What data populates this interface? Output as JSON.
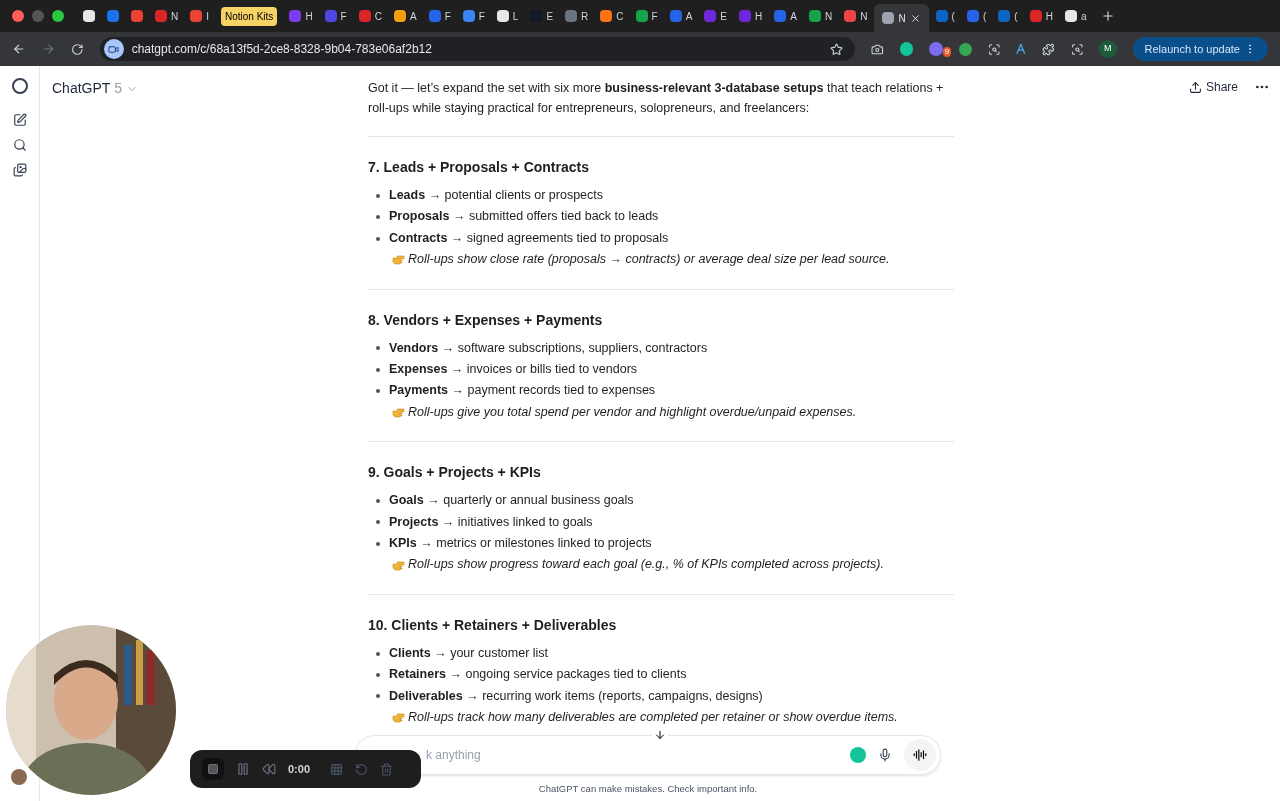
{
  "browser": {
    "tabs": [
      {
        "color": "#e5e7eb",
        "selected": false
      },
      {
        "color": "#1a73e8",
        "selected": false
      },
      {
        "color": "#ea4335",
        "selected": false
      },
      {
        "label": "N",
        "color": "#dc2626",
        "selected": false
      },
      {
        "label": "I",
        "color": "#ea4335",
        "selected": false
      },
      {
        "label": "Notion Kits",
        "color": "#f6d365",
        "selected": false
      },
      {
        "label": "H",
        "color": "#7c3aed",
        "selected": false
      },
      {
        "label": "F",
        "color": "#4f46e5",
        "selected": false
      },
      {
        "label": "C",
        "color": "#dc2626",
        "selected": false
      },
      {
        "label": "A",
        "color": "#f59e0b",
        "selected": false
      },
      {
        "label": "F",
        "color": "#2563eb",
        "selected": false
      },
      {
        "label": "F",
        "color": "#3b82f6",
        "selected": false
      },
      {
        "label": "L",
        "color": "#e5e7eb",
        "selected": false
      },
      {
        "label": "E",
        "color": "#111827",
        "selected": false
      },
      {
        "label": "R",
        "color": "#6b7280",
        "selected": false
      },
      {
        "label": "C",
        "color": "#f97316",
        "selected": false
      },
      {
        "label": "F",
        "color": "#16a34a",
        "selected": false
      },
      {
        "label": "A",
        "color": "#2563eb",
        "selected": false
      },
      {
        "label": "E",
        "color": "#6d28d9",
        "selected": false
      },
      {
        "label": "H",
        "color": "#6d28d9",
        "selected": false
      },
      {
        "label": "A",
        "color": "#2563eb",
        "selected": false
      },
      {
        "label": "N",
        "color": "#16a34a",
        "selected": false
      },
      {
        "label": "N",
        "color": "#ef4444",
        "selected": false
      },
      {
        "label": "N",
        "color": "#9ca3af",
        "selected": true
      },
      {
        "label": "(",
        "color": "#0a66c2",
        "selected": false
      },
      {
        "label": "(",
        "color": "#2563eb",
        "selected": false
      },
      {
        "label": "(",
        "color": "#0a66c2",
        "selected": false
      },
      {
        "label": "H",
        "color": "#dc2626",
        "selected": false
      },
      {
        "label": "a",
        "color": "#e5e7eb",
        "selected": false
      }
    ],
    "url": "chatgpt.com/c/68a13f5d-2ce8-8328-9b04-783e06af2b12",
    "extension_badge": "9",
    "profile": "M",
    "relaunch_button": "Relaunch to update"
  },
  "header": {
    "model": "ChatGPT",
    "version": "5",
    "share": "Share"
  },
  "intro": "Got it — let’s expand the set with six more **business-relevant 3-database setups** that teach relations + roll-ups while staying practical for entrepreneurs, solopreneurs, and freelancers:",
  "sections": [
    {
      "title": "7. Leads + Proposals + Contracts",
      "items": [
        {
          "term": "Leads",
          "desc": "→ potential clients or prospects"
        },
        {
          "term": "Proposals",
          "desc": "→ submitted offers tied back to leads"
        },
        {
          "term": "Contracts",
          "desc": "→ signed agreements tied to proposals"
        }
      ],
      "note": "Roll-ups show close rate (proposals → contracts) or average deal size per lead source."
    },
    {
      "title": "8. Vendors + Expenses + Payments",
      "items": [
        {
          "term": "Vendors",
          "desc": "→ software subscriptions, suppliers, contractors"
        },
        {
          "term": "Expenses",
          "desc": "→ invoices or bills tied to vendors"
        },
        {
          "term": "Payments",
          "desc": "→ payment records tied to expenses"
        }
      ],
      "note": "Roll-ups give you total spend per vendor and highlight overdue/unpaid expenses."
    },
    {
      "title": "9. Goals + Projects + KPIs",
      "items": [
        {
          "term": "Goals",
          "desc": "→ quarterly or annual business goals"
        },
        {
          "term": "Projects",
          "desc": "→ initiatives linked to goals"
        },
        {
          "term": "KPIs",
          "desc": "→ metrics or milestones linked to projects"
        }
      ],
      "note": "Roll-ups show progress toward each goal (e.g., % of KPIs completed across projects)."
    },
    {
      "title": "10. Clients + Retainers + Deliverables",
      "items": [
        {
          "term": "Clients",
          "desc": "→ your customer list"
        },
        {
          "term": "Retainers",
          "desc": "→ ongoing service packages tied to clients"
        },
        {
          "term": "Deliverables",
          "desc": "→ recurring work items (reports, campaigns, designs)"
        }
      ],
      "note": "Roll-ups track how many deliverables are completed per retainer or show overdue items."
    }
  ],
  "composer": {
    "placeholder": "k anything"
  },
  "disclaimer": "ChatGPT can make mistakes. Check important info.",
  "recorder": {
    "time": "0:00"
  }
}
